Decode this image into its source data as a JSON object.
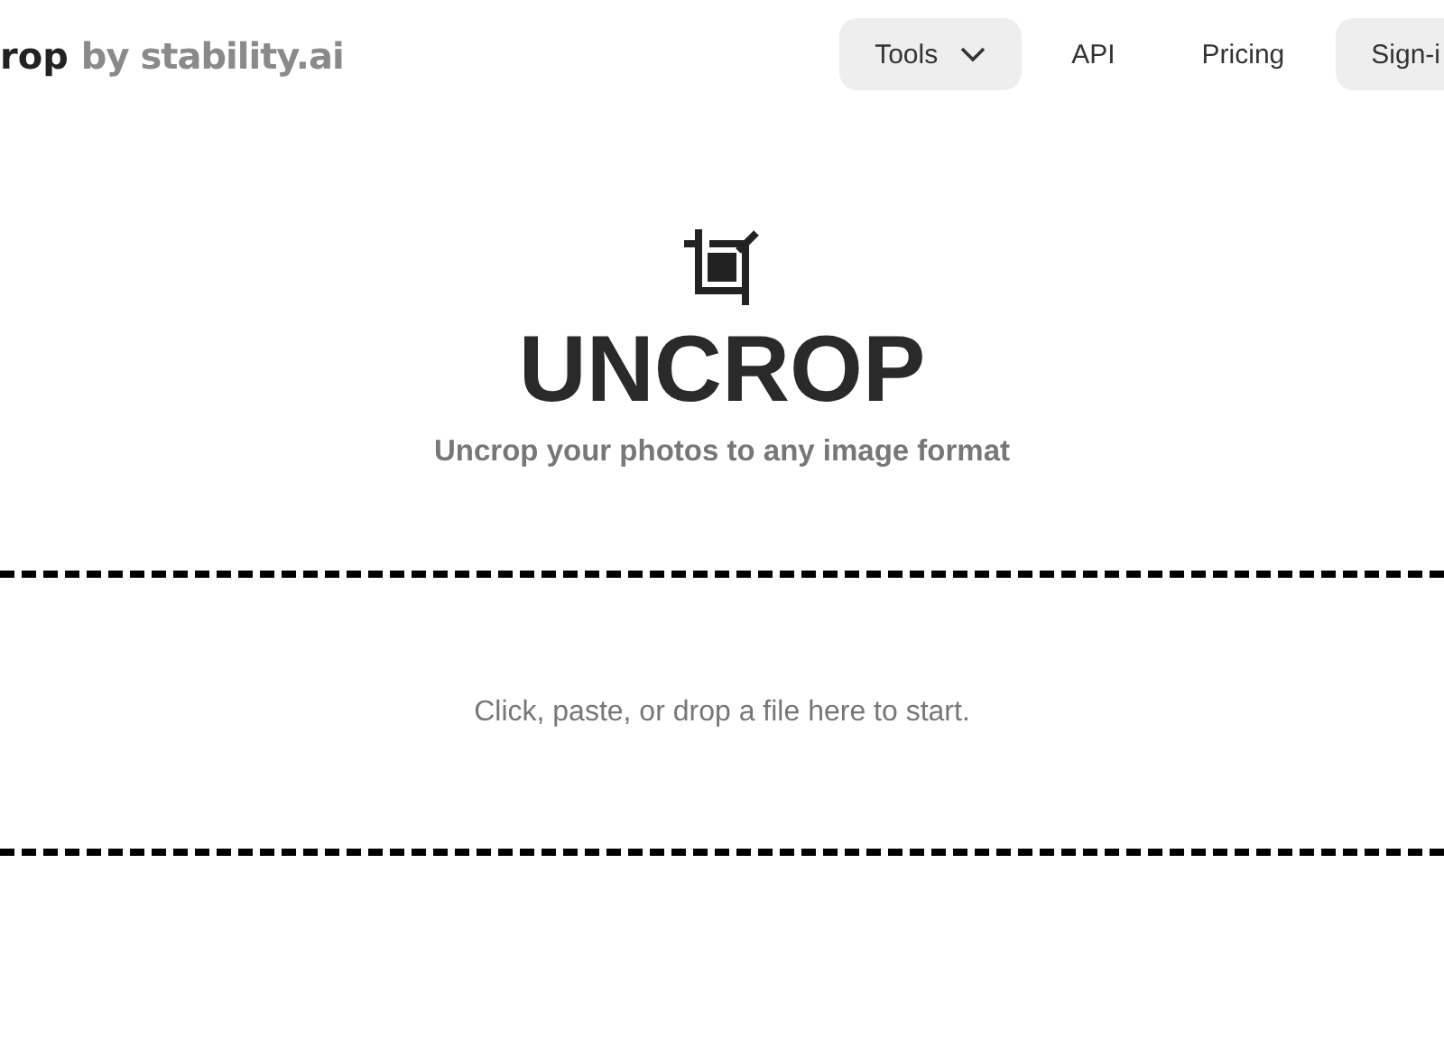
{
  "header": {
    "logo_main": "rop",
    "logo_sub": "by stability.ai",
    "nav": [
      {
        "label": "Tools",
        "kind": "dropdown"
      },
      {
        "label": "API",
        "kind": "link"
      },
      {
        "label": "Pricing",
        "kind": "link"
      },
      {
        "label": "Sign-i",
        "kind": "pill"
      }
    ]
  },
  "hero": {
    "title": "UNCROP",
    "subtitle": "Uncrop your photos to any image format"
  },
  "dropzone": {
    "prompt": "Click, paste, or drop a file here to start."
  }
}
